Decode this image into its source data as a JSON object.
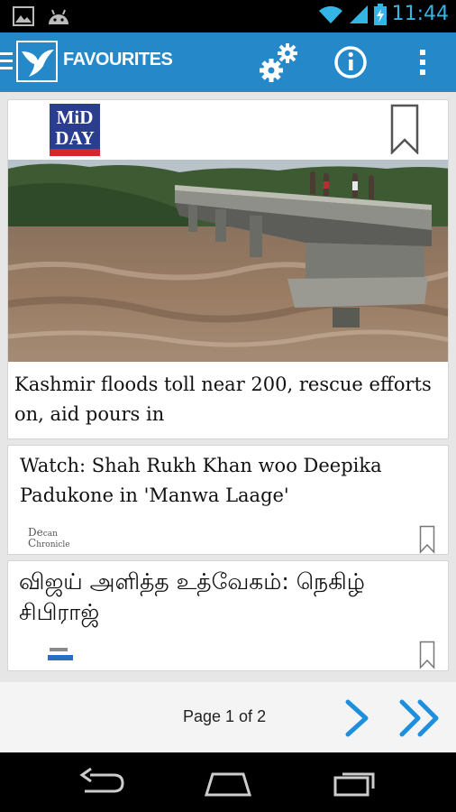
{
  "status_bar": {
    "time": "11:44",
    "icons": [
      "image-icon",
      "android-icon",
      "wifi-icon",
      "signal-icon",
      "battery-charging-icon"
    ]
  },
  "app_bar": {
    "title": "FAVOURITES",
    "icons": [
      "menu-icon",
      "app-logo-bird-icon",
      "settings-gears-icon",
      "info-icon",
      "overflow-menu-icon"
    ]
  },
  "articles": [
    {
      "publisher_logo_text": [
        "MiD",
        "DAY"
      ],
      "headline": "Kashmir floods toll near 200, rescue efforts on, aid pours in",
      "has_image": true
    },
    {
      "publisher_logo_text": [
        "De",
        "can",
        "C",
        "hronicle"
      ],
      "headline": "Watch: Shah Rukh Khan woo Deepika Padukone in 'Manwa Laage'"
    },
    {
      "headline": "விஜய் அளித்த உத்வேகம்: நெகிழ் சிபிராஜ்"
    }
  ],
  "pager": {
    "label": "Page 1 of 2",
    "current_page": 1,
    "total_pages": 2
  },
  "colors": {
    "app_bar": "#2588c8",
    "accent": "#33b5e5",
    "pager_arrows": "#1e8fdc"
  }
}
